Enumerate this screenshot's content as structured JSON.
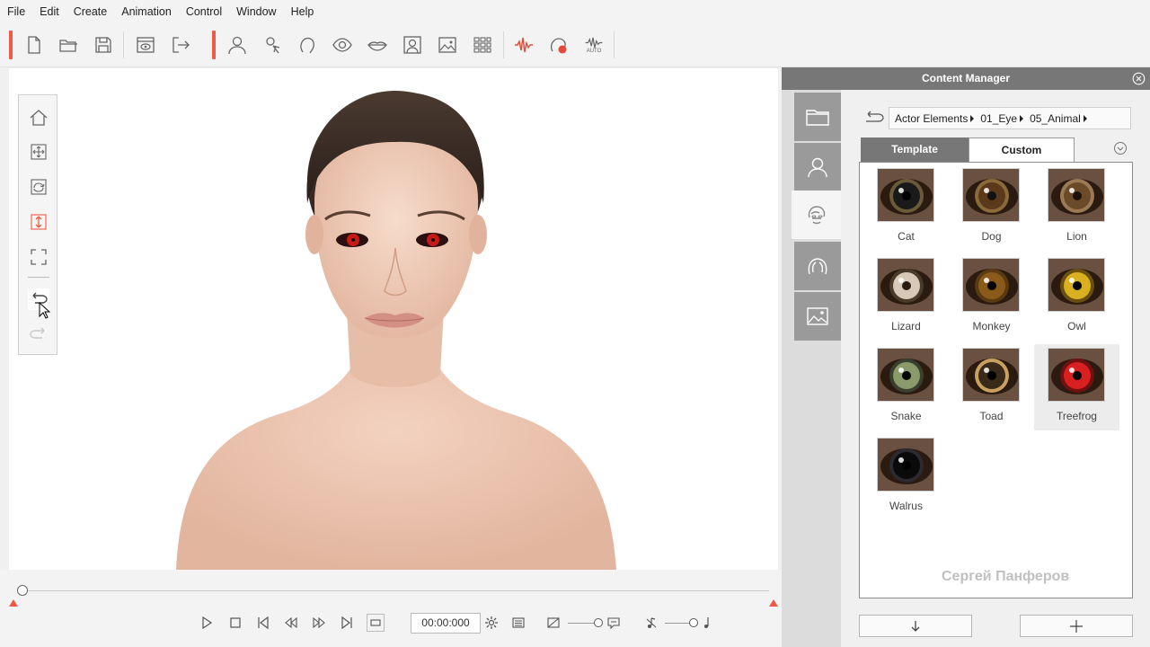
{
  "menubar": {
    "items": [
      "File",
      "Edit",
      "Create",
      "Animation",
      "Control",
      "Window",
      "Help"
    ]
  },
  "toolbar": {
    "icons": [
      "new-file-icon",
      "open-folder-icon",
      "save-icon",
      "preview-icon",
      "export-icon",
      "actor-icon",
      "motion-icon",
      "head-icon",
      "eye-icon",
      "lips-icon",
      "portrait-icon",
      "image-icon",
      "grid-icon",
      "audio-wave-icon",
      "voice-record-icon",
      "auto-lipsync-icon"
    ],
    "auto_label": "AUTO",
    "accent": "#ee5a45"
  },
  "side_toolbar": {
    "icons": [
      "home-icon",
      "move-icon",
      "rotate-icon",
      "zoom-icon",
      "fit-icon",
      "undo-icon",
      "redo-icon"
    ]
  },
  "timeline": {
    "time": "00:00:000"
  },
  "content_manager": {
    "title": "Content Manager",
    "breadcrumb": [
      "Actor Elements",
      "01_Eye",
      "05_Animal"
    ],
    "tabs": {
      "template": "Template",
      "custom": "Custom"
    },
    "active_tab": "Template",
    "sidebar_icons": [
      "folder-icon",
      "actor-profile-icon",
      "face-parts-icon",
      "hair-icon",
      "background-image-icon"
    ],
    "items": [
      {
        "label": "Cat",
        "iris": "#1a1a1a",
        "ring": "#6b5a3a",
        "pupil": "#000000",
        "selected": false
      },
      {
        "label": "Dog",
        "iris": "#5a3a1a",
        "ring": "#8b6a3a",
        "pupil": "#111111",
        "selected": false
      },
      {
        "label": "Lion",
        "iris": "#6b4a2a",
        "ring": "#9a7a55",
        "pupil": "#1a1208",
        "selected": false
      },
      {
        "label": "Lizard",
        "iris": "#d8c8b8",
        "ring": "#4a3a2a",
        "pupil": "#2a1a10",
        "selected": false
      },
      {
        "label": "Monkey",
        "iris": "#8a5a1a",
        "ring": "#5a3a10",
        "pupil": "#000000",
        "selected": false
      },
      {
        "label": "Owl",
        "iris": "#d8b020",
        "ring": "#6a5010",
        "pupil": "#000000",
        "selected": false
      },
      {
        "label": "Snake",
        "iris": "#8a9a6a",
        "ring": "#3a4030",
        "pupil": "#000000",
        "selected": false
      },
      {
        "label": "Toad",
        "iris": "#3a2a1a",
        "ring": "#c8a060",
        "pupil": "#000000",
        "selected": false
      },
      {
        "label": "Treefrog",
        "iris": "#d82020",
        "ring": "#701010",
        "pupil": "#000000",
        "selected": true
      },
      {
        "label": "Walrus",
        "iris": "#0a0a0a",
        "ring": "#2a2a30",
        "pupil": "#000000",
        "selected": false
      }
    ],
    "watermark": "Сергей Панферов",
    "footer": [
      "download-icon",
      "add-icon"
    ]
  }
}
